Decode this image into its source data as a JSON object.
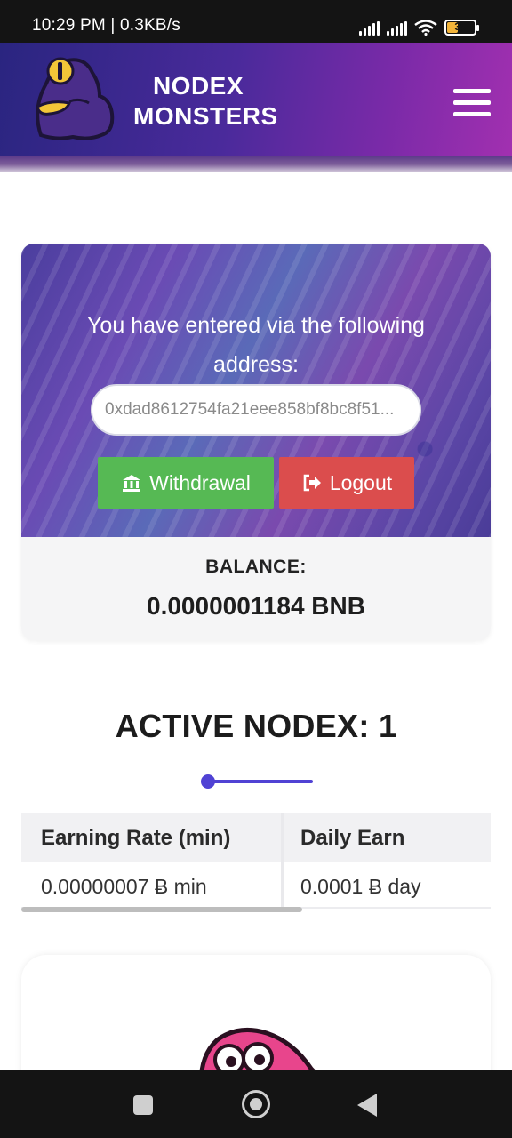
{
  "status_bar": {
    "time_speed": "10:29 PM | 0.3KB/s",
    "battery_level": "39"
  },
  "header": {
    "logo_line1": "NODEX",
    "logo_line2": "MONSTERS",
    "menu_icon": "hamburger-menu-icon"
  },
  "wallet": {
    "intro_text": "You have entered via the following address:",
    "address_value": "0xdad8612754fa21eee858bf8bc8f51...",
    "withdrawal_label": "Withdrawal",
    "logout_label": "Logout",
    "balance_label": "BALANCE:",
    "balance_value": "0.0000001184 BNB"
  },
  "nodex": {
    "title": "ACTIVE NODEX: 1",
    "table": {
      "headers": [
        "Earning Rate (min)",
        "Daily Earn"
      ],
      "rows": [
        [
          "0.00000007 Ƀ min",
          "0.0001 Ƀ day"
        ]
      ]
    }
  },
  "colors": {
    "header_gradient_start": "#2a2580",
    "header_gradient_end": "#a230b0",
    "withdraw_green": "#56b954",
    "logout_red": "#db4d4d",
    "accent_indigo": "#5042d4"
  }
}
